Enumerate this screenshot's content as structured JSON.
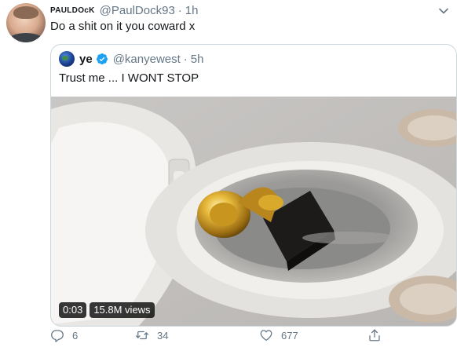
{
  "tweet": {
    "display_name": "PAULDOcK",
    "handle": "@PaulDock93",
    "separator": "·",
    "time": "1h",
    "text": "Do a shit on it you coward x",
    "actions": {
      "reply_count": "6",
      "retweet_count": "34",
      "like_count": "677"
    }
  },
  "quoted_tweet": {
    "display_name": "ye",
    "handle": "@kanyewest",
    "separator": "·",
    "time": "5h",
    "text": "Trust me ... I WONT STOP",
    "video": {
      "duration": "0:03",
      "views": "15.8M views"
    }
  },
  "icons": {
    "more": "chevron-down-icon",
    "verified": "verified-badge-icon",
    "reply": "reply-icon",
    "retweet": "retweet-icon",
    "like": "heart-icon",
    "share": "share-icon"
  },
  "colors": {
    "text": "#14171a",
    "muted": "#657786",
    "border": "#ccd6dd",
    "verified": "#1da1f2"
  }
}
